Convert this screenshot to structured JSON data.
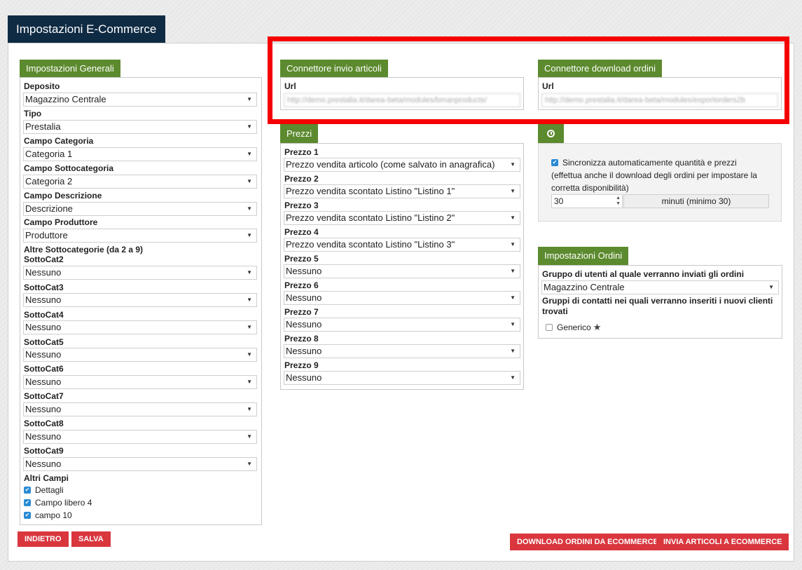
{
  "page_title": "Impostazioni E-Commerce",
  "general": {
    "tab": "Impostazioni Generali",
    "deposito_label": "Deposito",
    "deposito_value": "Magazzino Centrale",
    "tipo_label": "Tipo",
    "tipo_value": "Prestalia",
    "campo_categoria_label": "Campo Categoria",
    "campo_categoria_value": "Categoria 1",
    "campo_sottocategoria_label": "Campo Sottocategoria",
    "campo_sottocategoria_value": "Categoria 2",
    "campo_descrizione_label": "Campo Descrizione",
    "campo_descrizione_value": "Descrizione",
    "campo_produttore_label": "Campo Produttore",
    "campo_produttore_value": "Produttore",
    "altre_label": "Altre Sottocategorie (da 2 a 9)",
    "sottocat": [
      {
        "label": "SottoCat2",
        "value": "Nessuno"
      },
      {
        "label": "SottoCat3",
        "value": "Nessuno"
      },
      {
        "label": "SottoCat4",
        "value": "Nessuno"
      },
      {
        "label": "SottoCat5",
        "value": "Nessuno"
      },
      {
        "label": "SottoCat6",
        "value": "Nessuno"
      },
      {
        "label": "SottoCat7",
        "value": "Nessuno"
      },
      {
        "label": "SottoCat8",
        "value": "Nessuno"
      },
      {
        "label": "SottoCat9",
        "value": "Nessuno"
      }
    ],
    "altri_campi_label": "Altri Campi",
    "altri_campi": [
      {
        "label": "Dettagli",
        "checked": true
      },
      {
        "label": "Campo libero 4",
        "checked": true
      },
      {
        "label": "campo 10",
        "checked": true
      }
    ]
  },
  "connettore_invio": {
    "tab": "Connettore invio articoli",
    "url_label": "Url",
    "url_value": "http://demo.prestalia.it/darea-beta/modules/bmanproducts/"
  },
  "connettore_download": {
    "tab": "Connettore download ordini",
    "url_label": "Url",
    "url_value": "http://demo.prestalia.it/darea-beta/modules/exportorders2b"
  },
  "prezzi": {
    "tab": "Prezzi",
    "items": [
      {
        "label": "Prezzo 1",
        "value": "Prezzo vendita articolo (come salvato in anagrafica)"
      },
      {
        "label": "Prezzo 2",
        "value": "Prezzo vendita scontato Listino \"Listino 1\""
      },
      {
        "label": "Prezzo 3",
        "value": "Prezzo vendita scontato Listino \"Listino 2\""
      },
      {
        "label": "Prezzo 4",
        "value": "Prezzo vendita scontato Listino \"Listino 3\""
      },
      {
        "label": "Prezzo 5",
        "value": "Nessuno"
      },
      {
        "label": "Prezzo 6",
        "value": "Nessuno"
      },
      {
        "label": "Prezzo 7",
        "value": "Nessuno"
      },
      {
        "label": "Prezzo 8",
        "value": "Nessuno"
      },
      {
        "label": "Prezzo 9",
        "value": "Nessuno"
      }
    ]
  },
  "sync": {
    "line1": "Sincronizza automaticamente quantità e prezzi",
    "line2": "(effettua anche il download degli ordini per impostare la",
    "line3": "corretta disponibilità)",
    "minutes_value": "30",
    "minutes_label": "minuti (minimo 30)"
  },
  "ordini": {
    "tab": "Impostazioni Ordini",
    "gruppo_utenti_label": "Gruppo di utenti al quale verranno inviati gli ordini",
    "gruppo_utenti_value": "Magazzino Centrale",
    "gruppi_contatti_line1": "Gruppi di contatti nei quali verranno inseriti i nuovi clienti",
    "gruppi_contatti_line2": "trovati",
    "generico_label": "Generico"
  },
  "buttons": {
    "indietro": "INDIETRO",
    "salva": "SALVA",
    "download": "DOWNLOAD ORDINI DA ECOMMERCE",
    "invia": "INVIA ARTICOLI A ECOMMERCE"
  },
  "colors": {
    "header": "#0f2b44",
    "section_tab": "#5c8a2e",
    "button": "#d9363e",
    "highlight": "#f40000",
    "checkbox": "#2a8ad4"
  }
}
